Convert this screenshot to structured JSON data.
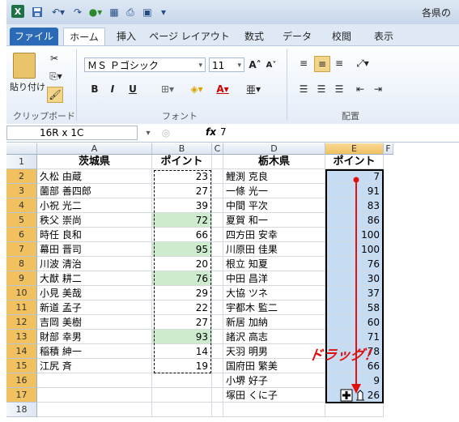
{
  "title_bar": {
    "doc_title": "各県の"
  },
  "tabs": [
    "ファイル",
    "ホーム",
    "挿入",
    "ページ レイアウト",
    "数式",
    "データ",
    "校閲",
    "表示"
  ],
  "ribbon": {
    "paste_label": "貼り付け",
    "clipboard_group": "クリップボード",
    "font_name": "ＭＳ Ｐゴシック",
    "font_size": "11",
    "font_group": "フォント",
    "align_group": "配置",
    "bold": "B",
    "italic": "I",
    "underline": "U",
    "font_grow": "A",
    "font_shrink": "A",
    "font_color": "A",
    "ruby": "亜"
  },
  "formula_bar": {
    "name_box": "16R x 1C",
    "fx": "fx",
    "value": "7"
  },
  "columns": [
    "A",
    "B",
    "C",
    "D",
    "E",
    "F"
  ],
  "header_row": {
    "a": "茨城県",
    "b": "ポイント",
    "d": "栃木県",
    "e": "ポイント"
  },
  "rows": [
    {
      "n": "2",
      "a": "久松 由蔵",
      "b": "23",
      "d": "鯉渕 克良",
      "e": "7"
    },
    {
      "n": "3",
      "a": "薗部 善四郎",
      "b": "27",
      "d": "一條 光一",
      "e": "91"
    },
    {
      "n": "4",
      "a": "小祝 光二",
      "b": "39",
      "d": "中間 平次",
      "e": "83"
    },
    {
      "n": "5",
      "a": "秩父 崇尚",
      "b": "72",
      "d": "夏賀 和一",
      "e": "86"
    },
    {
      "n": "6",
      "a": "時任 良和",
      "b": "66",
      "d": "四方田 安幸",
      "e": "100"
    },
    {
      "n": "7",
      "a": "幕田 晋司",
      "b": "95",
      "d": "川原田 佳果",
      "e": "100"
    },
    {
      "n": "8",
      "a": "川波 清治",
      "b": "20",
      "d": "根立 知夏",
      "e": "76"
    },
    {
      "n": "9",
      "a": "大猷 耕二",
      "b": "76",
      "d": "中田 昌洋",
      "e": "30"
    },
    {
      "n": "10",
      "a": "小見 美哉",
      "b": "29",
      "d": "大協 ツネ",
      "e": "37"
    },
    {
      "n": "11",
      "a": "新道 孟子",
      "b": "22",
      "d": "宇都木 監二",
      "e": "58"
    },
    {
      "n": "12",
      "a": "吉岡 美樹",
      "b": "27",
      "d": "新居 加納",
      "e": "60"
    },
    {
      "n": "13",
      "a": "財部 幸男",
      "b": "93",
      "d": "諸沢 高志",
      "e": "71"
    },
    {
      "n": "14",
      "a": "稲積 紳一",
      "b": "14",
      "d": "天羽 明男",
      "e": "78"
    },
    {
      "n": "15",
      "a": "江尻 斉",
      "b": "19",
      "d": "国府田 繁美",
      "e": "66"
    },
    {
      "n": "16",
      "a": "",
      "b": "",
      "d": "小堺 好子",
      "e": "9"
    },
    {
      "n": "17",
      "a": "",
      "b": "",
      "d": "塚田 くに子",
      "e": "26"
    },
    {
      "n": "18",
      "a": "",
      "b": "",
      "d": "",
      "e": ""
    }
  ],
  "annotation": "ドラッグ！",
  "colors": {
    "highlight_green": "#cdeccd",
    "selection_blue": "#c5dcf3",
    "arrow_red": "#e01010"
  }
}
